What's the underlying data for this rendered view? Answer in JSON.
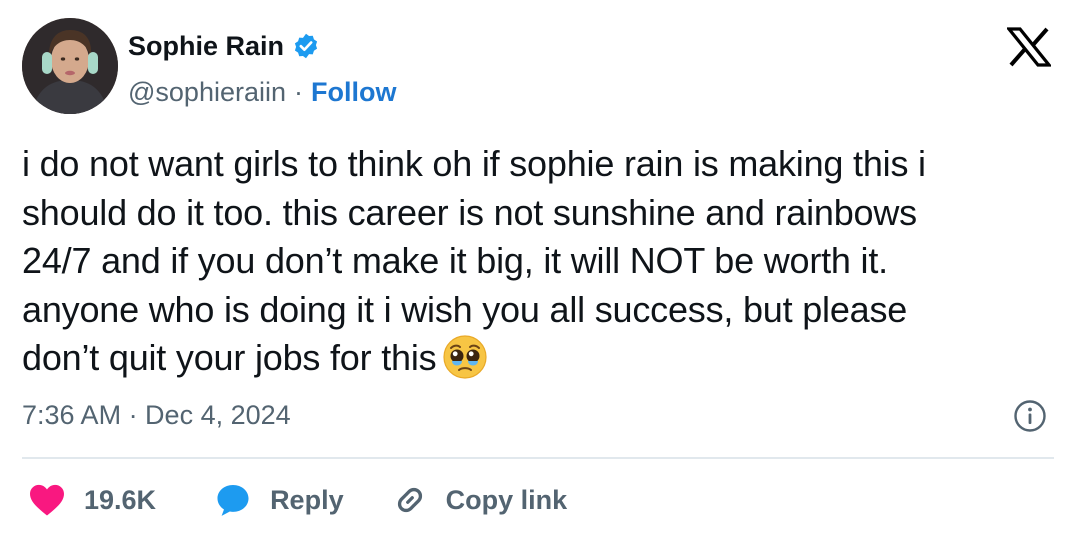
{
  "header": {
    "display_name": "Sophie Rain",
    "handle": "@sophieraiin",
    "separator": "·",
    "follow_label": "Follow"
  },
  "tweet": {
    "lines": [
      "i do not want girls to think oh if sophie rain is making this i",
      "should do it too. this career is not sunshine and rainbows",
      "24/7 and if you don’t make it big, it will NOT be worth it.",
      "anyone who is doing it i wish you all success, but please",
      "don’t quit your jobs for this"
    ],
    "emoji": "pleading-face-with-tears"
  },
  "meta": {
    "timestamp": "7:36 AM · Dec 4, 2024"
  },
  "actions": {
    "like_count": "19.6K",
    "reply_label": "Reply",
    "copy_link_label": "Copy link"
  },
  "icons": {
    "verified": "verified-badge-icon",
    "brand": "x-logo-icon",
    "info": "info-icon",
    "like": "heart-icon",
    "reply": "speech-bubble-icon",
    "copy_link": "link-icon"
  },
  "colors": {
    "text": "#0f1419",
    "secondary": "#536471",
    "accent": "#1d77d1",
    "verified": "#1d9bf0",
    "like": "#f91880",
    "reply": "#1d9bf0",
    "divider": "#e1e8ed"
  }
}
